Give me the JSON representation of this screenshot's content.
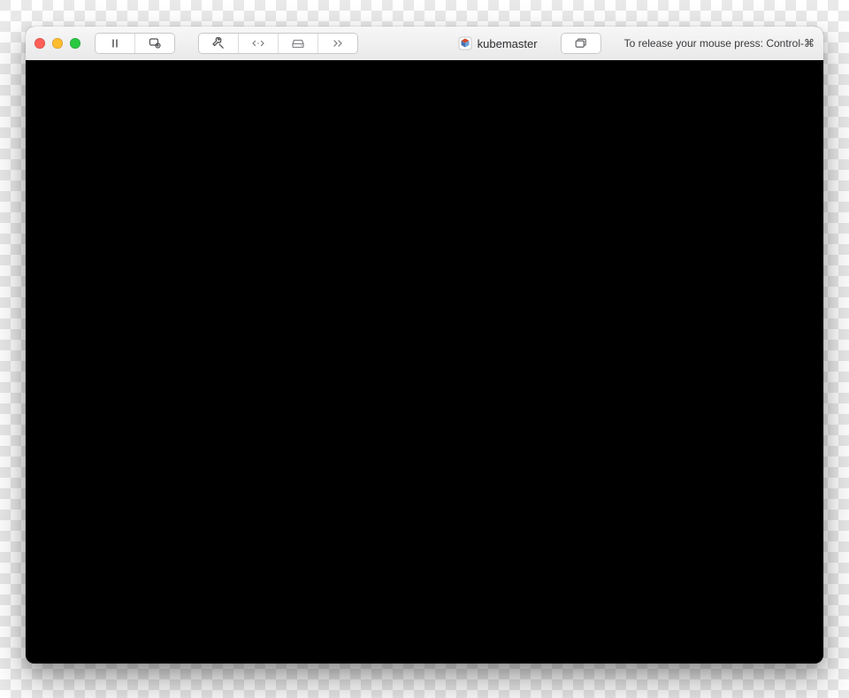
{
  "titlebar": {
    "vm_name": "kubemaster",
    "hint": "To release your mouse press: Control-⌘"
  }
}
